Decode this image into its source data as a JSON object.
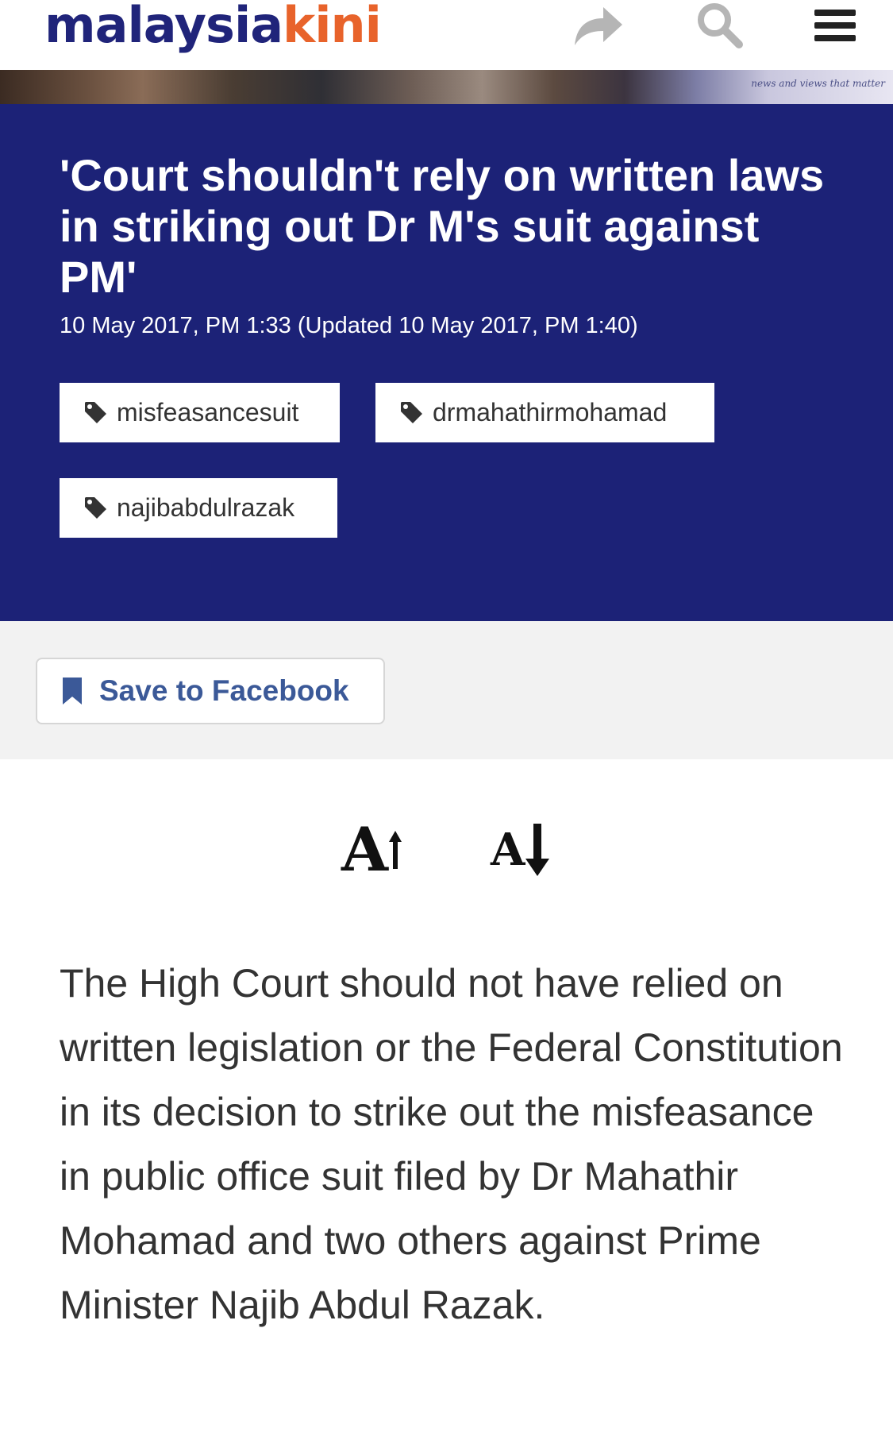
{
  "header": {
    "logo_part1": "malaysia",
    "logo_part2": "kini"
  },
  "photo": {
    "watermark": "news and views that matter"
  },
  "article": {
    "title": "'Court shouldn't rely on written laws in striking out Dr M's suit against PM'",
    "date": "10 May 2017, PM 1:33 (Updated 10 May 2017, PM 1:40)",
    "tags": [
      "misfeasancesuit",
      "drmahathirmohamad",
      "najibabdulrazak"
    ],
    "body": "The High Court should not have relied on written legislation or the Federal Constitution in its decision to strike out the misfeasance in public office suit filed by Dr Mahathir Mohamad and two others against Prime Minister Najib Abdul Razak."
  },
  "actions": {
    "save_label": "Save to Facebook"
  },
  "font_controls": {
    "letter": "A"
  },
  "icons": {
    "share": "share-arrow-icon",
    "search": "search-icon",
    "menu": "hamburger-menu-icon",
    "tag": "tag-icon",
    "bookmark": "bookmark-icon",
    "increase": "arrow-up-icon",
    "decrease": "arrow-down-icon"
  },
  "colors": {
    "brand_navy": "#20247a",
    "brand_orange": "#e8632b",
    "hero_bg": "#1c2277",
    "facebook_blue": "#3b5998"
  }
}
